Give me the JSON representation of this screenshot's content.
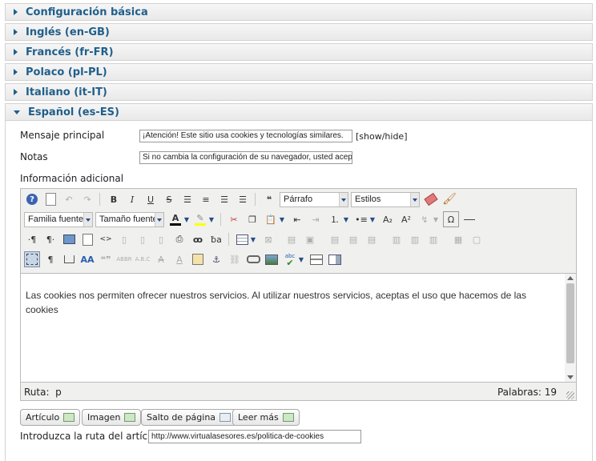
{
  "accordion": [
    {
      "label": "Configuración básica",
      "expanded": false
    },
    {
      "label": "Inglés (en-GB)",
      "expanded": false
    },
    {
      "label": "Francés (fr-FR)",
      "expanded": false
    },
    {
      "label": "Polaco (pl-PL)",
      "expanded": false
    },
    {
      "label": "Italiano (it-IT)",
      "expanded": false
    },
    {
      "label": "Español (es-ES)",
      "expanded": true
    }
  ],
  "fields": {
    "mensaje_label": "Mensaje principal",
    "mensaje_value": "¡Atención! Este sitio usa cookies y tecnologías similares.",
    "show_hide": "[show/hide]",
    "notas_label": "Notas",
    "notas_value": "Si no cambia la configuración de su navegador, usted acepta su uso.",
    "info_label": "Información adicional"
  },
  "editor": {
    "format_select": "Párrafo",
    "styles_select": "Estilos",
    "font_family_select": "Familia fuente",
    "font_size_select": "Tamaño fuente",
    "content": "Las cookies nos permiten ofrecer nuestros servicios. Al utilizar nuestros servicios, aceptas el uso que hacemos de las cookies",
    "path_label": "Ruta:",
    "path_value": "p",
    "words_label": "Palabras:",
    "words_value": "19"
  },
  "buttons": {
    "articulo": "Artículo",
    "imagen": "Imagen",
    "salto": "Salto de página",
    "leer_mas": "Leer más"
  },
  "article_path": {
    "label": "Introduzca la ruta del artículo",
    "value": "http://www.virtualasesores.es/politica-de-cookies"
  },
  "colors": {
    "accent": "#1f5f8b"
  }
}
